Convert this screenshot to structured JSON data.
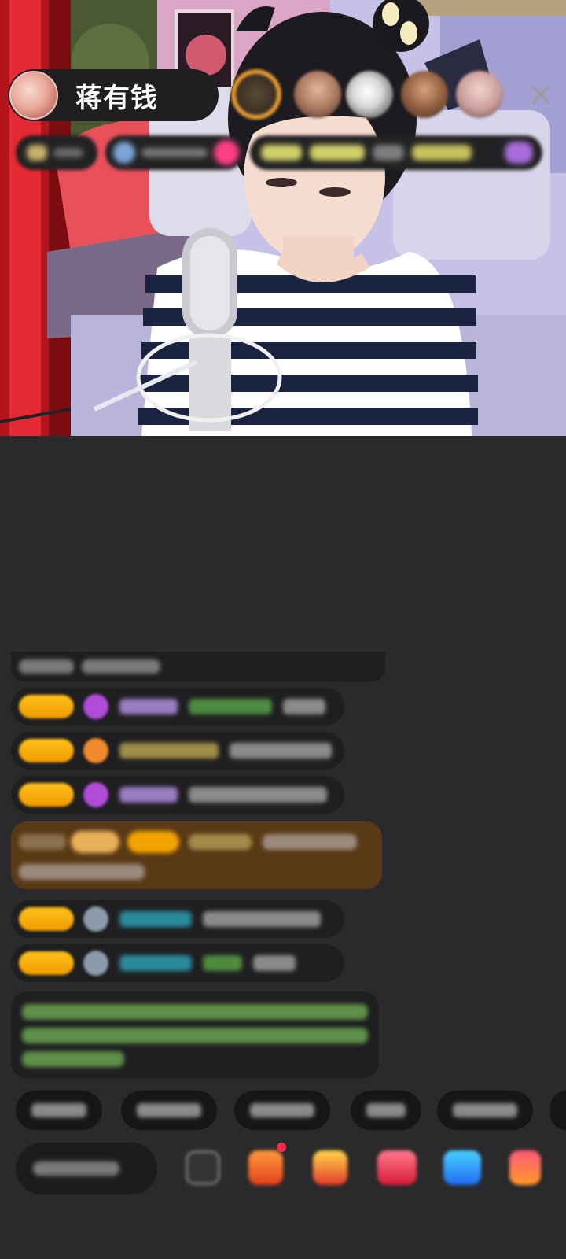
{
  "header": {
    "host_name": "蒋有钱",
    "close_icon": "×"
  },
  "icons": {
    "host_avatar": "avatar",
    "viewers": [
      "viewer-avatar",
      "viewer-avatar",
      "viewer-avatar",
      "viewer-avatar",
      "viewer-avatar"
    ],
    "close": "close-icon",
    "gift": "gift-icon",
    "more": "more-icon"
  },
  "colors": {
    "background": "#2a2a2c",
    "pill": "#1f1f21",
    "badge_gold": "#ffc21a",
    "promo_bubble": "#5a3a16",
    "system_text_green": "#7cc35b",
    "username_purple": "#b48ae0",
    "username_teal": "#2aa3b5"
  }
}
